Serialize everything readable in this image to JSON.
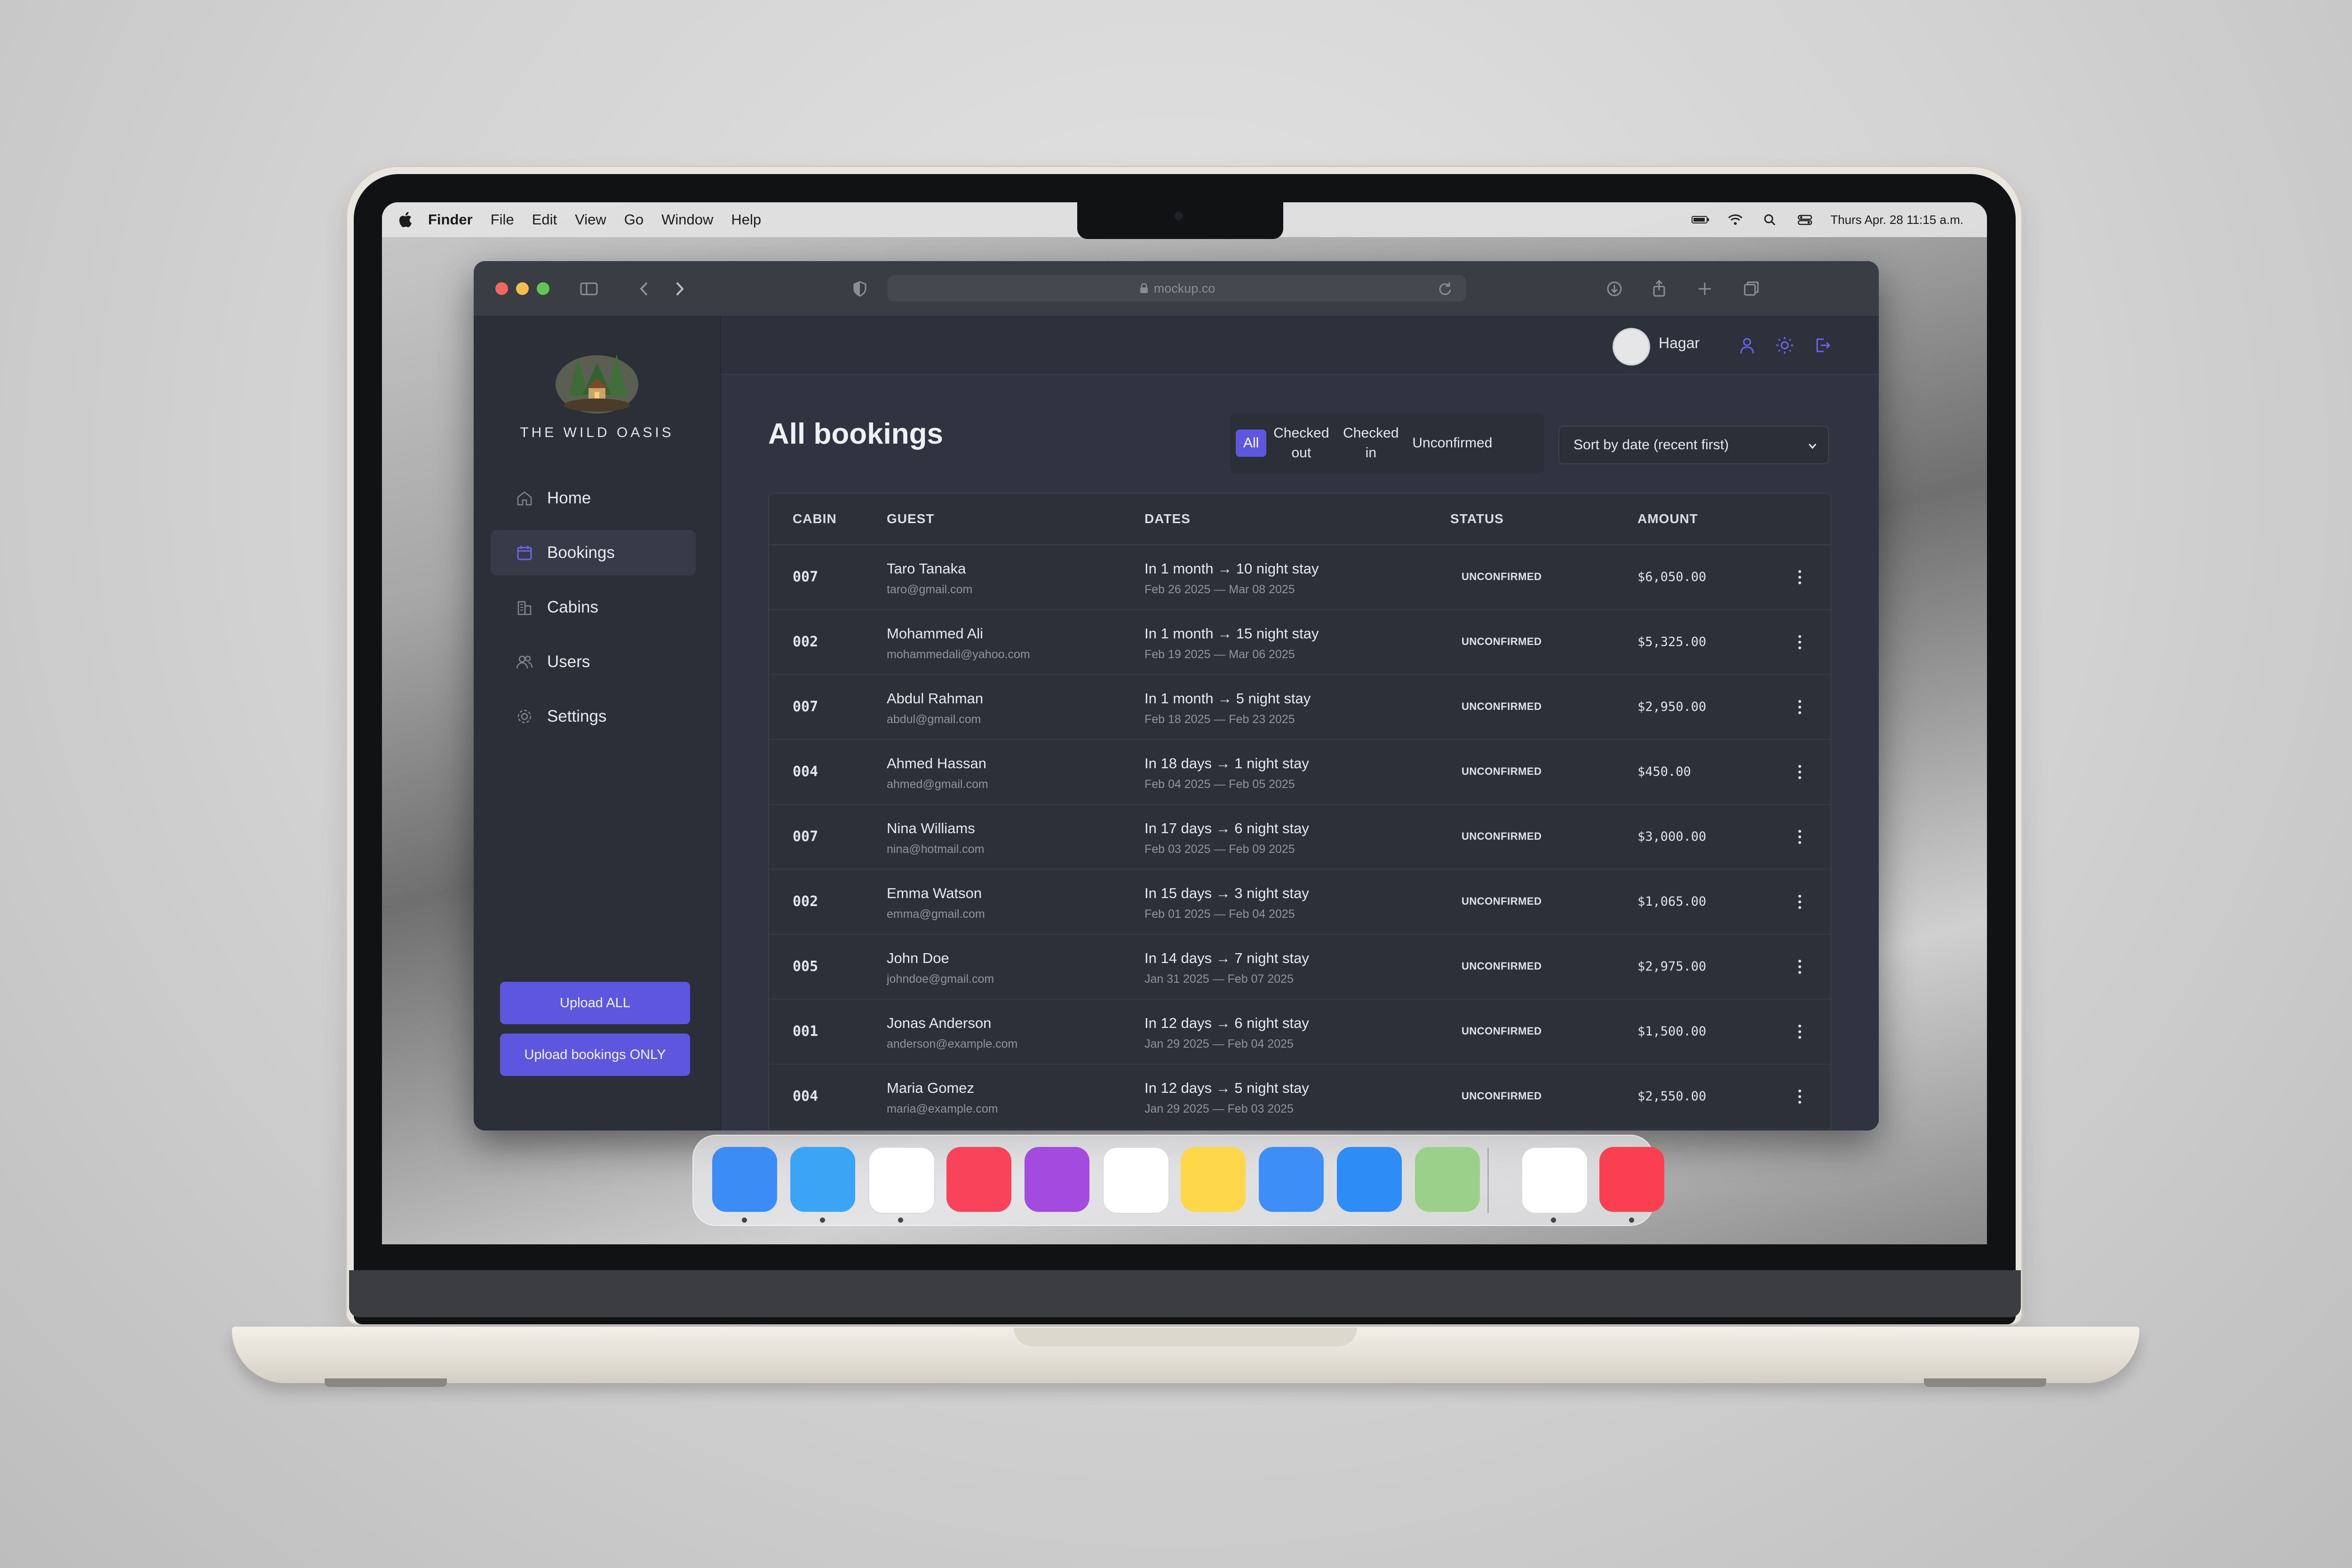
{
  "menubar": {
    "items": [
      "Finder",
      "File",
      "Edit",
      "View",
      "Go",
      "Window",
      "Help"
    ],
    "clock": "Thurs Apr. 28 11:15 a.m."
  },
  "browser": {
    "url": "mockup.co"
  },
  "sidebar": {
    "logo_text": "THE WILD OASIS",
    "items": [
      {
        "label": "Home",
        "icon": "home-icon"
      },
      {
        "label": "Bookings",
        "icon": "calendar-icon"
      },
      {
        "label": "Cabins",
        "icon": "building-icon"
      },
      {
        "label": "Users",
        "icon": "users-icon"
      },
      {
        "label": "Settings",
        "icon": "gear-icon"
      }
    ],
    "active": "Bookings",
    "upload_all": "Upload ALL",
    "upload_bookings": "Upload bookings ONLY"
  },
  "header": {
    "user_name": "Hagar"
  },
  "page": {
    "title": "All bookings",
    "filters": [
      "All",
      "Checked out",
      "Checked in",
      "Unconfirmed"
    ],
    "active_filter": "All",
    "sort_value": "Sort by date (recent first)"
  },
  "table": {
    "columns": [
      "CABIN",
      "GUEST",
      "DATES",
      "STATUS",
      "AMOUNT"
    ],
    "rows": [
      {
        "cabin": "007",
        "guest": "Taro Tanaka",
        "email": "taro@gmail.com",
        "dates": "In 1 month → 10 night stay",
        "range": "Feb 26 2025 — Mar 08 2025",
        "status": "UNCONFIRMED",
        "amount": "$6,050.00"
      },
      {
        "cabin": "002",
        "guest": "Mohammed Ali",
        "email": "mohammedali@yahoo.com",
        "dates": "In 1 month → 15 night stay",
        "range": "Feb 19 2025 — Mar 06 2025",
        "status": "UNCONFIRMED",
        "amount": "$5,325.00"
      },
      {
        "cabin": "007",
        "guest": "Abdul Rahman",
        "email": "abdul@gmail.com",
        "dates": "In 1 month → 5 night stay",
        "range": "Feb 18 2025 — Feb 23 2025",
        "status": "UNCONFIRMED",
        "amount": "$2,950.00"
      },
      {
        "cabin": "004",
        "guest": "Ahmed Hassan",
        "email": "ahmed@gmail.com",
        "dates": "In 18 days → 1 night stay",
        "range": "Feb 04 2025 — Feb 05 2025",
        "status": "UNCONFIRMED",
        "amount": "$450.00"
      },
      {
        "cabin": "007",
        "guest": "Nina Williams",
        "email": "nina@hotmail.com",
        "dates": "In 17 days → 6 night stay",
        "range": "Feb 03 2025 — Feb 09 2025",
        "status": "UNCONFIRMED",
        "amount": "$3,000.00"
      },
      {
        "cabin": "002",
        "guest": "Emma Watson",
        "email": "emma@gmail.com",
        "dates": "In 15 days → 3 night stay",
        "range": "Feb 01 2025 — Feb 04 2025",
        "status": "UNCONFIRMED",
        "amount": "$1,065.00"
      },
      {
        "cabin": "005",
        "guest": "John Doe",
        "email": "johndoe@gmail.com",
        "dates": "In 14 days → 7 night stay",
        "range": "Jan 31 2025 — Feb 07 2025",
        "status": "UNCONFIRMED",
        "amount": "$2,975.00"
      },
      {
        "cabin": "001",
        "guest": "Jonas Anderson",
        "email": "anderson@example.com",
        "dates": "In 12 days → 6 night stay",
        "range": "Jan 29 2025 — Feb 04 2025",
        "status": "UNCONFIRMED",
        "amount": "$1,500.00"
      },
      {
        "cabin": "004",
        "guest": "Maria Gomez",
        "email": "maria@example.com",
        "dates": "In 12 days → 5 night stay",
        "range": "Jan 29 2025 — Feb 03 2025",
        "status": "UNCONFIRMED",
        "amount": "$2,550.00"
      }
    ]
  },
  "dock": {
    "apps": [
      "finder-icon",
      "safari-icon",
      "slack-icon",
      "music-icon",
      "podcasts-icon",
      "reminders-icon",
      "notes-icon",
      "mail-icon",
      "app-store-icon",
      "maps-icon",
      "photos-icon",
      "news-icon"
    ],
    "colors": [
      "#3b8cf5",
      "#3ba4f5",
      "#ffffff",
      "#f9435a",
      "#a44bdf",
      "#ffffff",
      "#ffd84a",
      "#3d8ef7",
      "#2d8cf5",
      "#9bd08a",
      "#ffffff",
      "#fa4050"
    ]
  }
}
